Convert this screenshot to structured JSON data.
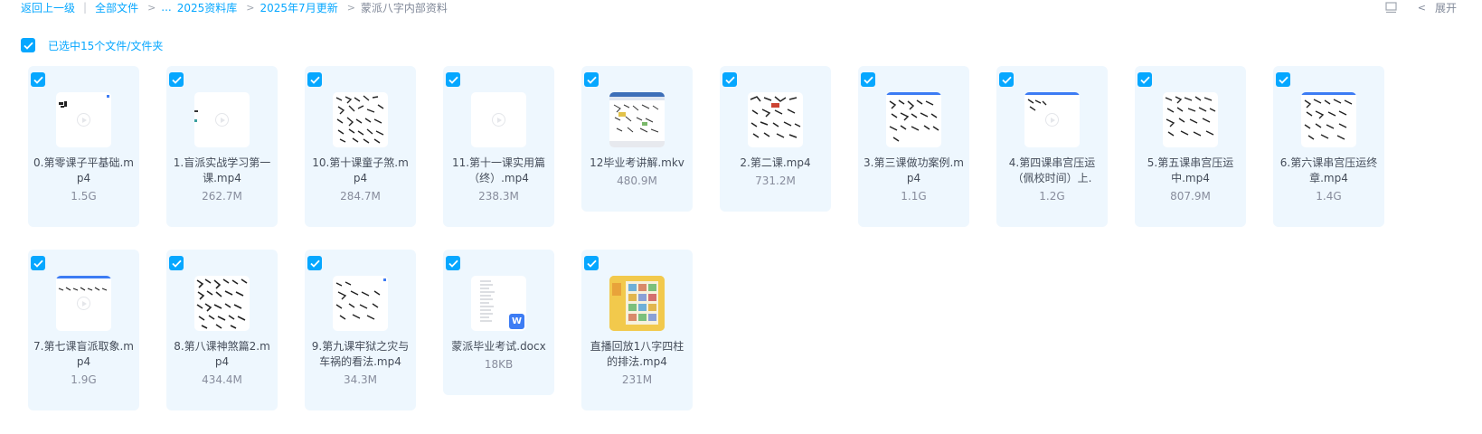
{
  "breadcrumb": {
    "back": "返回上一级",
    "separator": "|",
    "all_files": "全部文件",
    "ellipsis": "...",
    "folder1": "2025资料库",
    "folder2": "2025年7月更新",
    "current": "蒙派八字内部资料"
  },
  "toolbar": {
    "expand_label": "展开"
  },
  "selection": {
    "label": "已选中15个文件/文件夹"
  },
  "colors": {
    "accent": "#06a7ff",
    "card_bg": "#eef7fe"
  },
  "files": [
    {
      "name": "0.第零课子平基础.mp4",
      "size": "1.5G",
      "kind": "video"
    },
    {
      "name": "1.盲派实战学习第一课.mp4",
      "size": "262.7M",
      "kind": "video"
    },
    {
      "name": "10.第十课童子煞.mp4",
      "size": "284.7M",
      "kind": "video"
    },
    {
      "name": "11.第十一课实用篇（终）.mp4",
      "size": "238.3M",
      "kind": "video"
    },
    {
      "name": "12毕业考讲解.mkv",
      "size": "480.9M",
      "kind": "video"
    },
    {
      "name": "2.第二课.mp4",
      "size": "731.2M",
      "kind": "video"
    },
    {
      "name": "3.第三课做功案例.mp4",
      "size": "1.1G",
      "kind": "video"
    },
    {
      "name": "4.第四课串宫压运（佩校时间）上.",
      "size": "1.2G",
      "kind": "video"
    },
    {
      "name": "5.第五课串宫压运中.mp4",
      "size": "807.9M",
      "kind": "video"
    },
    {
      "name": "6.第六课串宫压运终章.mp4",
      "size": "1.4G",
      "kind": "video"
    },
    {
      "name": "7.第七课盲派取象.mp4",
      "size": "1.9G",
      "kind": "video"
    },
    {
      "name": "8.第八课神煞篇2.mp4",
      "size": "434.4M",
      "kind": "video"
    },
    {
      "name": "9.第九课牢狱之灾与车祸的看法.mp4",
      "size": "34.3M",
      "kind": "video"
    },
    {
      "name": "蒙派毕业考试.docx",
      "size": "18KB",
      "kind": "doc",
      "badge": "W"
    },
    {
      "name": "直播回放1八字四柱的排法.mp4",
      "size": "231M",
      "kind": "image-video"
    }
  ]
}
